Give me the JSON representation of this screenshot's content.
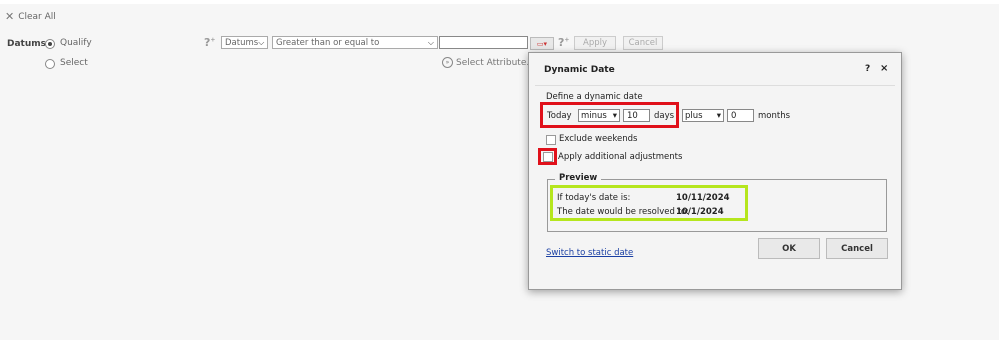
{
  "toolbar": {
    "clear_all": "Clear All"
  },
  "filter": {
    "field_label": "Datums",
    "mode_options": [
      "Qualify",
      "Select"
    ],
    "selected_mode": "Qualify",
    "attribute_select": "Datums",
    "operator_select": "Greater than or equal to",
    "value_input": "",
    "apply_label": "Apply",
    "cancel_label": "Cancel",
    "select_attribute_label": "Select Attribute..."
  },
  "dialog": {
    "title": "Dynamic Date",
    "help": "?",
    "close": "×",
    "define_label": "Define a dynamic date",
    "today_label": "Today",
    "op1": "minus",
    "num1": "10",
    "unit1": "days",
    "op2": "plus",
    "num2": "0",
    "unit2": "months",
    "exclude_weekends": "Exclude weekends",
    "apply_adjustments": "Apply additional adjustments",
    "preview": {
      "legend": "Preview",
      "today_label": "If today's date is:",
      "today_value": "10/11/2024",
      "resolved_label": "The date would be resolved to:",
      "resolved_value": "10/1/2024"
    },
    "switch_link": "Switch to static date",
    "ok_label": "OK",
    "cancel_label": "Cancel"
  },
  "colors": {
    "highlight_red": "#e0101a",
    "highlight_green": "#b5e61d",
    "link": "#1a3fa3"
  }
}
